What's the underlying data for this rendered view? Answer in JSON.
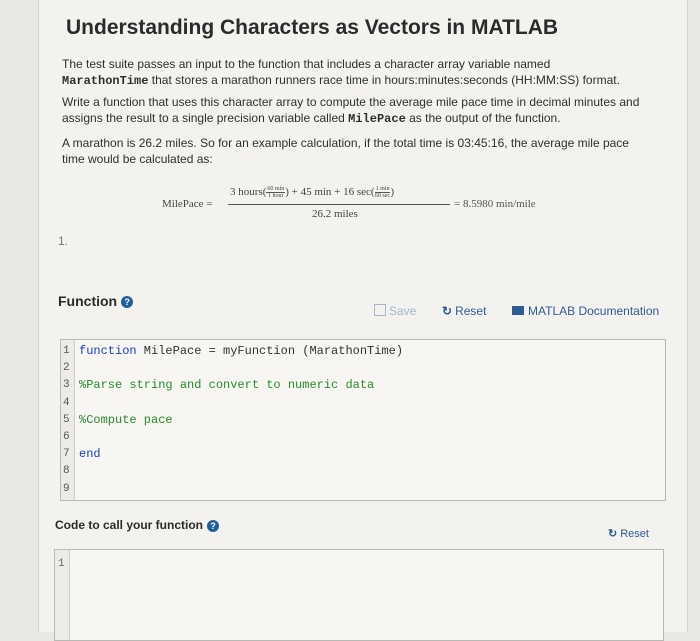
{
  "page": {
    "title": "Understanding Characters as Vectors in MATLAB"
  },
  "description": {
    "p1_text": "The test suite passes an input to the function that includes a character array variable named",
    "p1_var": "MarathonTime",
    "p1_rest": " that stores a marathon runners race time in hours:minutes:seconds (HH:MM:SS) format.",
    "p2_text": "Write a function that uses this character array to compute the average mile pace time in decimal minutes and assigns the result to a single precision variable called ",
    "p2_var": "MilePace",
    "p2_rest": " as the output of the function.",
    "p3_text": "A marathon is 26.2 miles. So for an example calculation, if the total time is 03:45:16, the average mile pace time would be calculated as:"
  },
  "equation": {
    "lhs": "MilePace =",
    "num_a": "3 hours(",
    "f1_top": "60 min",
    "f1_bot": "1 hour",
    "num_b": ") + 45 min + 16 sec(",
    "f2_top": "1 min",
    "f2_bot": "60 sec",
    "num_c": ")",
    "denominator": "26.2 miles",
    "rhs": "= 8.5980 min/mile"
  },
  "stray_mark": "1.",
  "function_section": {
    "label": "Function",
    "save_label": "Save",
    "reset_label": "Reset",
    "docs_label": "MATLAB Documentation"
  },
  "code_lines": [
    {
      "n": "1",
      "kw": "function",
      "rest": " MilePace = myFunction (MarathonTime)",
      "type": "kw"
    },
    {
      "n": "2",
      "text": "",
      "type": "plain"
    },
    {
      "n": "3",
      "text": "%Parse string and convert to numeric data",
      "type": "cm"
    },
    {
      "n": "4",
      "text": "",
      "type": "plain"
    },
    {
      "n": "5",
      "text": "%Compute pace",
      "type": "cm"
    },
    {
      "n": "6",
      "text": "",
      "type": "plain"
    },
    {
      "n": "7",
      "text": "end",
      "type": "kwonly"
    },
    {
      "n": "8",
      "text": "",
      "type": "plain"
    },
    {
      "n": "9",
      "text": "",
      "type": "plain"
    }
  ],
  "call_section": {
    "label": "Code to call your function",
    "reset_label": "Reset",
    "line_1": "1"
  },
  "colors": {
    "keyword": "#1a3cc7",
    "comment": "#2b8a2b",
    "link": "#2f5b92",
    "help_icon": "#1f5f9e"
  }
}
